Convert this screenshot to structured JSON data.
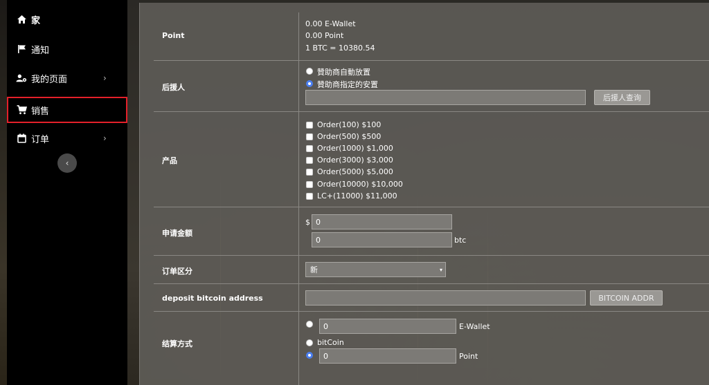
{
  "sidebar": {
    "items": [
      {
        "label": "家",
        "icon": "home-icon"
      },
      {
        "label": "通知",
        "icon": "flag-icon"
      },
      {
        "label": "我的页面",
        "icon": "user-cog-icon",
        "arrow": "›"
      },
      {
        "label": "销售",
        "icon": "cart-icon"
      },
      {
        "label": "订单",
        "icon": "calendar-icon",
        "arrow": "›"
      }
    ],
    "collapse": "‹"
  },
  "form": {
    "point": {
      "label": "Point",
      "lines": [
        "0.00 E-Wallet",
        "0.00 Point",
        "1 BTC = 10380.54"
      ]
    },
    "sponsor": {
      "label": "后援人",
      "option_auto": "贊助商自動放置",
      "option_specified": "贊助商指定的安置",
      "input_value": "",
      "button": "后援人查询"
    },
    "products": {
      "label": "产品",
      "options": [
        "Order(100) $100",
        "Order(500) $500",
        "Order(1000) $1,000",
        "Order(3000) $3,000",
        "Order(5000) $5,000",
        "Order(10000) $10,000",
        "LC+(11000) $11,000"
      ]
    },
    "amount": {
      "label": "申请金额",
      "currency": "$",
      "usd_value": "0",
      "btc_value": "0",
      "btc_unit": "btc"
    },
    "order_type": {
      "label": "订单区分",
      "selected": "新",
      "caret": "▾"
    },
    "deposit": {
      "label": "deposit bitcoin address",
      "input_value": "",
      "button": "BITCOIN ADDR"
    },
    "payment": {
      "label": "结算方式",
      "ewallet_value": "0",
      "ewallet_unit": "E-Wallet",
      "bitcoin_label": "bitCoin",
      "point_value": "0",
      "point_unit": "Point"
    }
  },
  "colors": {
    "sidebar_bg": "#000000",
    "panel_bg": "#5c5a56",
    "active_outline": "#e4202a",
    "radio_checked": "#4a7ef0"
  }
}
